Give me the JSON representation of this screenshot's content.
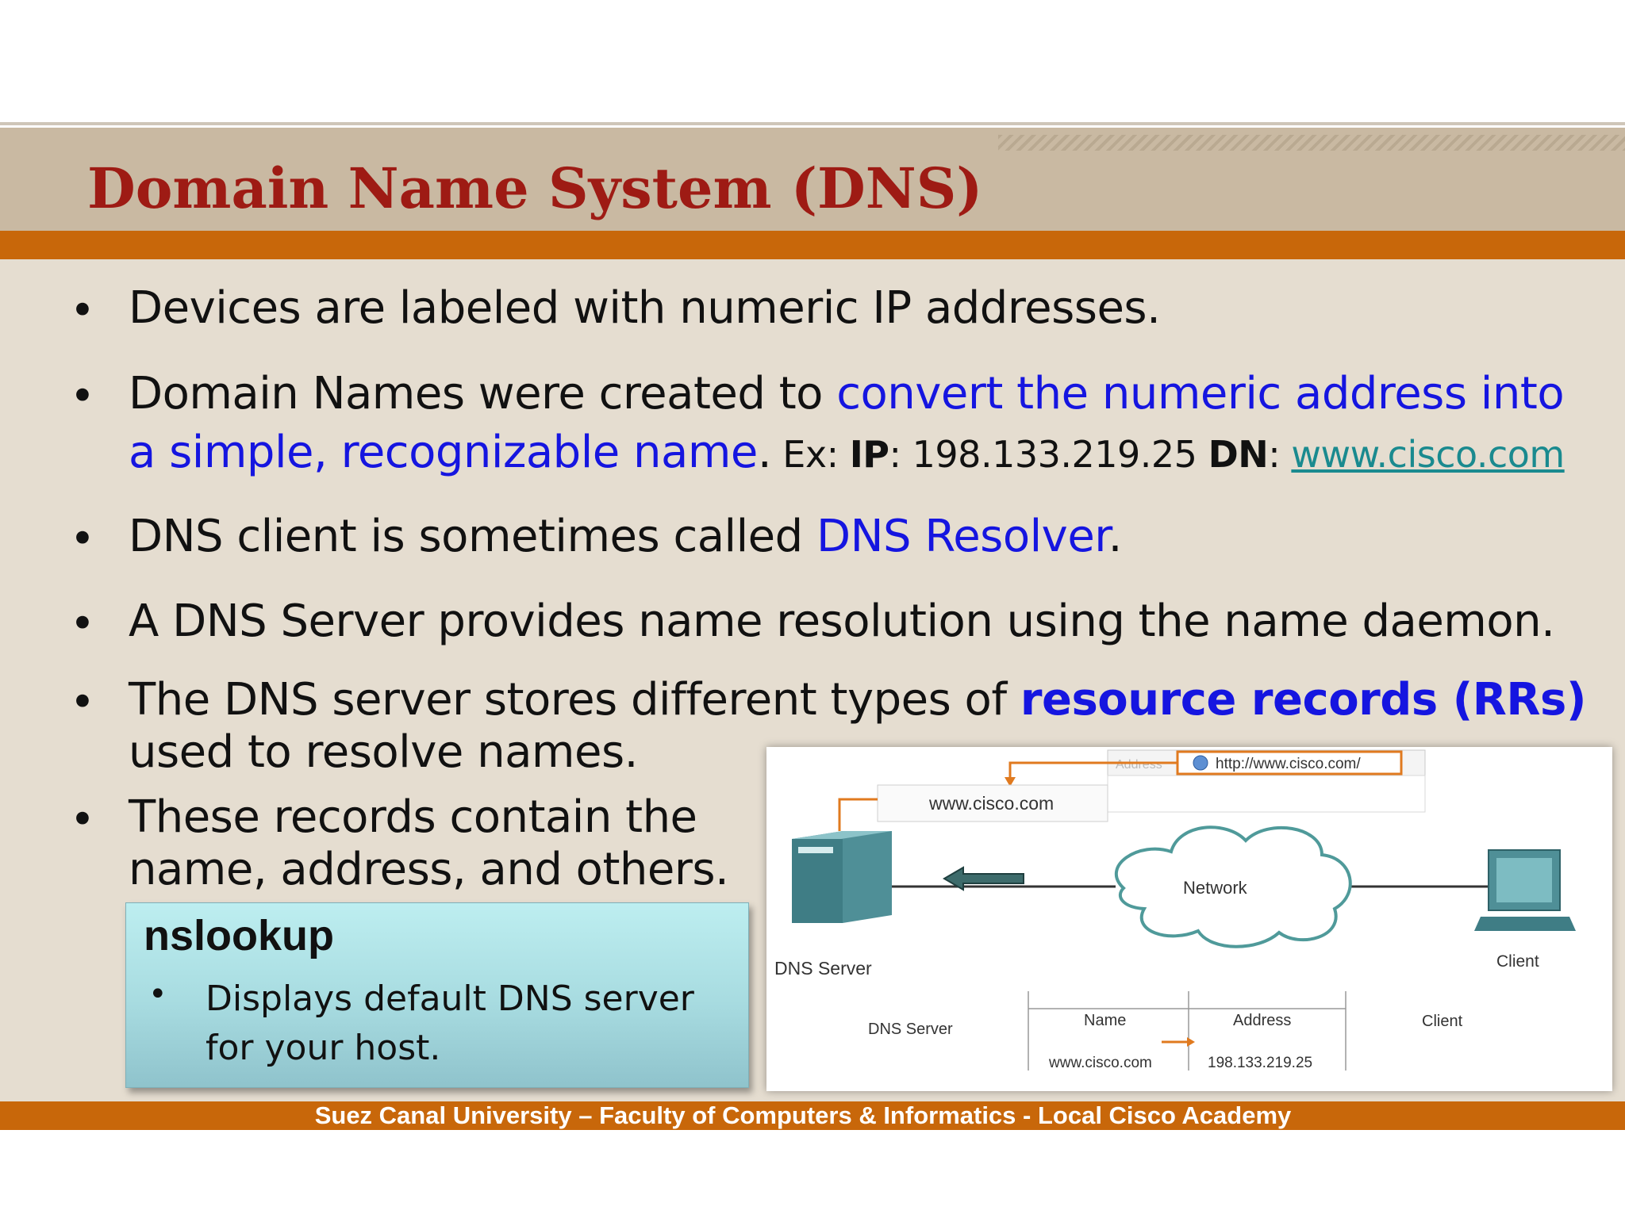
{
  "slide": {
    "title": "Domain Name System (DNS)",
    "footer": "Suez Canal University – Faculty of Computers & Informatics - Local Cisco Academy"
  },
  "bullets": {
    "b1": "Devices are labeled with numeric IP addresses.",
    "b2_plain": "Domain Names were created to ",
    "b2_blue_line1": "convert the numeric address into",
    "b2_blue_line2": "a simple, recognizable name",
    "b2_period": ".",
    "b2_ex": " Ex: ",
    "b2_ip_label": "IP",
    "b2_ip_value": ": 198.133.219.25 ",
    "b2_dn_label": "DN",
    "b2_colon": ": ",
    "b2_link": "www.cisco.com",
    "b3_plain": "DNS client is sometimes called ",
    "b3_blue": "DNS Resolver",
    "b3_period": ".",
    "b4": "A DNS Server provides name resolution using the name daemon.",
    "b5_plain": "The DNS server stores different types of ",
    "b5_blue": "resource records (RRs)",
    "b5_line2": "used to resolve names.",
    "b6_line1": "These records contain the",
    "b6_line2": "name, address, and others."
  },
  "callout": {
    "title": "nslookup",
    "text": "Displays default DNS server for your host."
  },
  "figure": {
    "address_label": "Address",
    "url": "http://www.cisco.com/",
    "query_box": "www.cisco.com",
    "network": "Network",
    "dns_server": "DNS Server",
    "client": "Client",
    "table_left": "DNS Server",
    "table_right": "Client",
    "col_name": "Name",
    "col_address": "Address",
    "row_name": "www.cisco.com",
    "row_address": "198.133.219.25"
  },
  "colors": {
    "title": "#9e1b14",
    "accent_bar": "#c8670a",
    "header_band": "#c9b9a2",
    "content_bg": "#e5ddd0",
    "highlight": "#1515e0"
  }
}
